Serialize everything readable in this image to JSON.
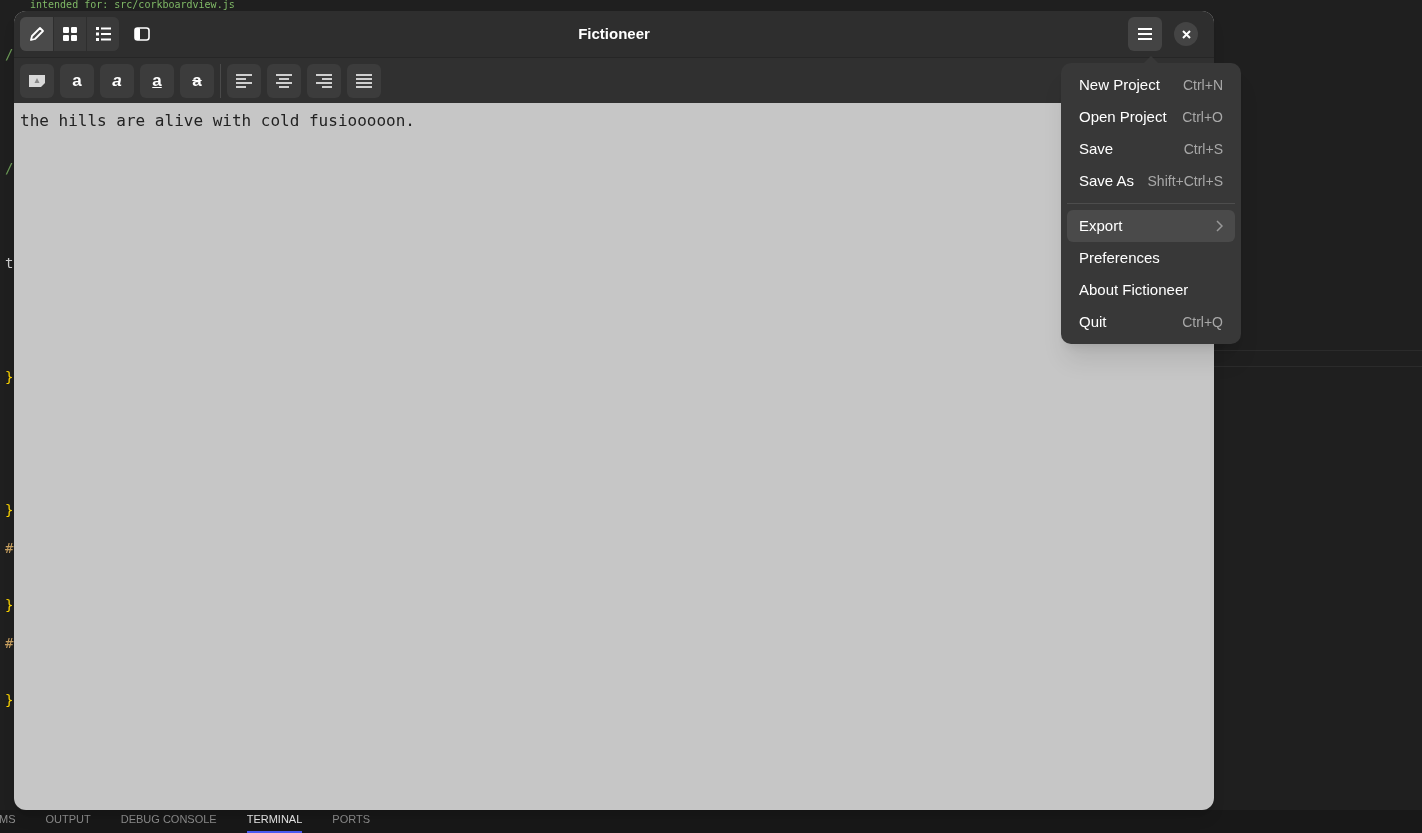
{
  "background_editor": {
    "comment": "intended for: src/corkboardview.js",
    "fragments": [
      {
        "text": "/"
      },
      {
        "text": "/"
      },
      {
        "text": "t"
      },
      {
        "text": "}"
      },
      {
        "text": "}"
      },
      {
        "text": "#"
      },
      {
        "text": "}"
      },
      {
        "text": "#"
      },
      {
        "text": "}"
      }
    ]
  },
  "panel_tabs": [
    {
      "label": "MS",
      "selected": false
    },
    {
      "label": "OUTPUT",
      "selected": false
    },
    {
      "label": "DEBUG CONSOLE",
      "selected": false
    },
    {
      "label": "TERMINAL",
      "selected": true
    },
    {
      "label": "PORTS",
      "selected": false
    }
  ],
  "window": {
    "title": "Fictioneer",
    "menu_open": true
  },
  "view_switcher": [
    {
      "kind": "write",
      "selected": true
    },
    {
      "kind": "grid",
      "selected": false
    },
    {
      "kind": "list",
      "selected": false
    }
  ],
  "format_buttons": [
    {
      "kind": "note"
    },
    {
      "kind": "bold",
      "label": "a"
    },
    {
      "kind": "italic",
      "label": "a"
    },
    {
      "kind": "underline",
      "label": "a"
    },
    {
      "kind": "strikethrough",
      "label": "a"
    }
  ],
  "align_buttons": [
    {
      "kind": "left"
    },
    {
      "kind": "center"
    },
    {
      "kind": "right"
    },
    {
      "kind": "justify"
    }
  ],
  "document": {
    "text": "the hills are alive with cold fusiooooon."
  },
  "menu": [
    [
      {
        "label": "New Project",
        "shortcut": "Ctrl+N",
        "selected": false
      },
      {
        "label": "Open Project",
        "shortcut": "Ctrl+O",
        "selected": false
      },
      {
        "label": "Save",
        "shortcut": "Ctrl+S",
        "selected": false
      },
      {
        "label": "Save As",
        "shortcut": "Shift+Ctrl+S",
        "selected": false
      }
    ],
    [
      {
        "label": "Export",
        "submenu": true,
        "selected": true
      },
      {
        "label": "Preferences",
        "selected": false
      },
      {
        "label": "About Fictioneer",
        "selected": false
      },
      {
        "label": "Quit",
        "shortcut": "Ctrl+Q",
        "selected": false
      }
    ]
  ]
}
